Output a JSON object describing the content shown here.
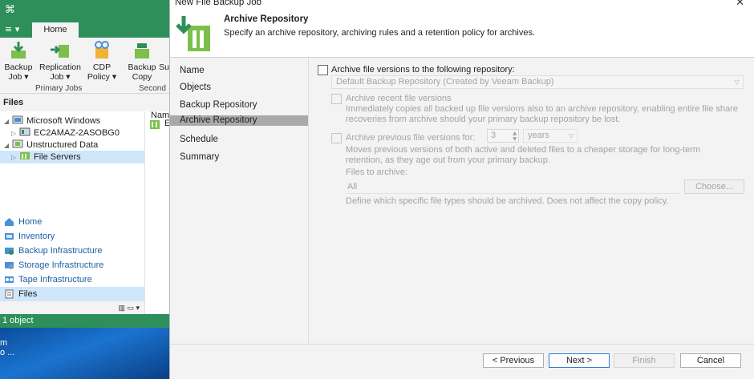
{
  "console": {
    "menu_label": "≡ ▾",
    "home_tab": "Home",
    "ribbon": [
      {
        "label": "Backup\nJob ▾"
      },
      {
        "label": "Replication\nJob ▾"
      },
      {
        "label": "CDP\nPolicy ▾"
      },
      {
        "label": "Backup\nCopy"
      },
      {
        "label": "Su"
      }
    ],
    "ribbon_groups": [
      "Primary Jobs",
      "Second"
    ],
    "files_header": "Files",
    "tree": [
      {
        "label": "Microsoft Windows",
        "icon": "windows-icon"
      },
      {
        "label": "EC2AMAZ-2ASOBG0",
        "icon": "server-icon"
      },
      {
        "label": "Unstructured Data",
        "icon": "unstructured-data-icon"
      },
      {
        "label": "File Servers",
        "icon": "file-servers-icon"
      }
    ],
    "list_fragment": "Nam",
    "list_fragment2": "E",
    "nav": [
      {
        "label": "Home",
        "icon": "home-icon"
      },
      {
        "label": "Inventory",
        "icon": "inventory-icon"
      },
      {
        "label": "Backup Infrastructure",
        "icon": "backup-infrastructure-icon"
      },
      {
        "label": "Storage Infrastructure",
        "icon": "storage-infrastructure-icon"
      },
      {
        "label": "Tape Infrastructure",
        "icon": "tape-infrastructure-icon"
      },
      {
        "label": "Files",
        "icon": "files-icon"
      }
    ],
    "status": "1 object",
    "desktop_fragments": [
      "m",
      "o ..."
    ]
  },
  "dialog": {
    "title": "New File Backup Job",
    "header_title": "Archive Repository",
    "header_desc": "Specify an archive repository, archiving rules and a retention policy for archives.",
    "steps": [
      "Name",
      "Objects",
      "Backup Repository",
      "Archive Repository",
      "Schedule",
      "Summary"
    ],
    "active_step": "Archive Repository",
    "archive_checkbox_label": "Archive file versions to the following repository:",
    "repository_value": "Default Backup Repository (Created by Veeam Backup)",
    "recent_label": "Archive recent file versions",
    "recent_desc": "Immediately copies all backed up file versions also to an archive repository, enabling entire file share recoveries from archive should your primary backup repository be lost.",
    "previous_label": "Archive previous file versions for:",
    "previous_value": "3",
    "previous_unit": "years",
    "previous_desc": "Moves previous versions of both active and deleted files to a cheaper storage for long-term retention, as they age out from your primary backup.",
    "files_to_archive_label": "Files to archive:",
    "files_to_archive_value": "All",
    "choose_button": "Choose...",
    "files_desc": "Define which specific file types should be archived. Does not affect the copy policy.",
    "buttons": {
      "previous": "< Previous",
      "next": "Next >",
      "finish": "Finish",
      "cancel": "Cancel"
    }
  },
  "colors": {
    "accent": "#2f8f5b",
    "active_step": "#a9a9a9",
    "nav_link": "#1d5fa6"
  }
}
